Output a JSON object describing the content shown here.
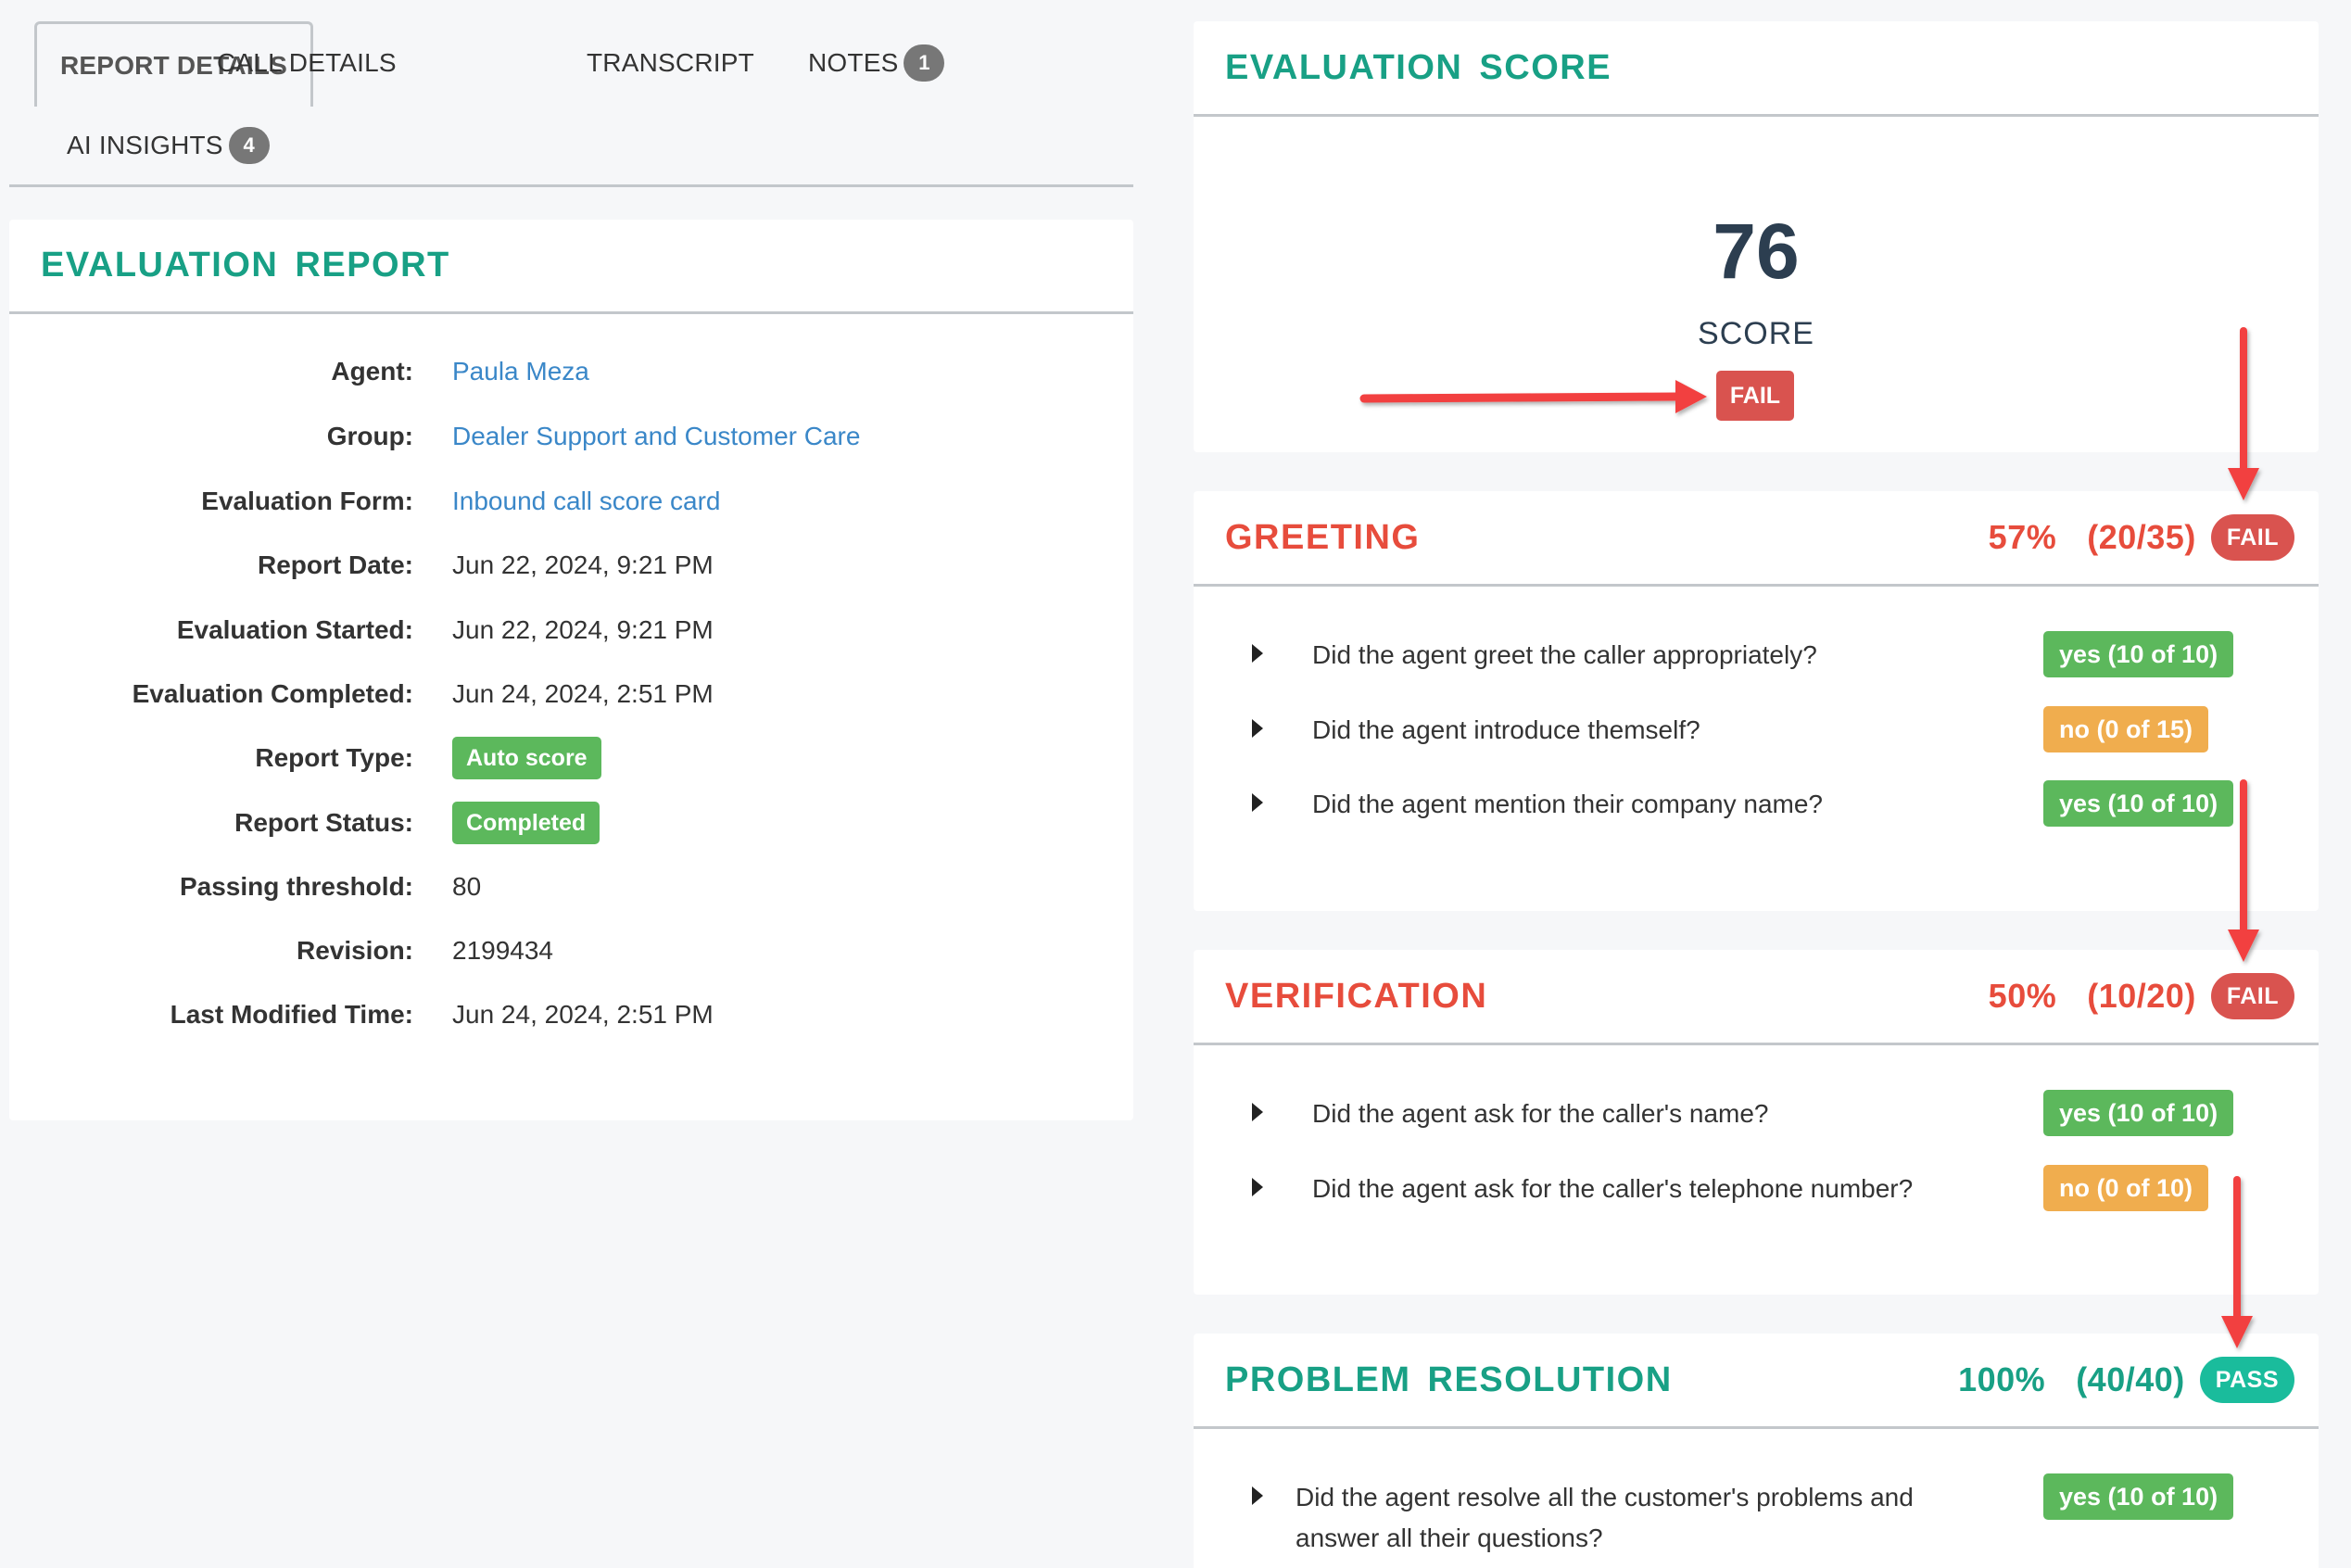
{
  "tabs": [
    {
      "label": "REPORT DETAILS",
      "active": true
    },
    {
      "label": "CALL DETAILS"
    },
    {
      "label": "TRANSCRIPT"
    },
    {
      "label": "NOTES",
      "count": "1"
    },
    {
      "label": "AI INSIGHTS",
      "count": "4"
    }
  ],
  "report": {
    "title": "EVALUATION REPORT",
    "rows": [
      {
        "label": "Agent:",
        "value": "Paula Meza",
        "type": "link"
      },
      {
        "label": "Group:",
        "value": "Dealer Support and Customer Care",
        "type": "link"
      },
      {
        "label": "Evaluation Form:",
        "value": "Inbound call score card",
        "type": "link"
      },
      {
        "label": "Report Date:",
        "value": "Jun 22, 2024, 9:21 PM",
        "type": "text"
      },
      {
        "label": "Evaluation Started:",
        "value": "Jun 22, 2024, 9:21 PM",
        "type": "text"
      },
      {
        "label": "Evaluation Completed:",
        "value": "Jun 24, 2024, 2:51 PM",
        "type": "text"
      },
      {
        "label": "Report Type:",
        "value": "Auto score",
        "type": "pill"
      },
      {
        "label": "Report Status:",
        "value": "Completed",
        "type": "pill"
      },
      {
        "label": "Passing threshold:",
        "value": "80",
        "type": "text"
      },
      {
        "label": "Revision:",
        "value": "2199434",
        "type": "text"
      },
      {
        "label": "Last Modified Time:",
        "value": "Jun 24, 2024, 2:51 PM",
        "type": "text"
      }
    ]
  },
  "score": {
    "title": "EVALUATION SCORE",
    "value": "76",
    "label": "SCORE",
    "result": "FAIL"
  },
  "sections": [
    {
      "title": "GREETING",
      "percent": "57%",
      "points": "(20/35)",
      "result": "FAIL",
      "status": "fail",
      "questions": [
        {
          "text": "Did the agent greet the caller appropriately?",
          "answer": "yes (10 of 10)",
          "status": "yes"
        },
        {
          "text": "Did the agent introduce themself?",
          "answer": "no (0 of 15)",
          "status": "no"
        },
        {
          "text": "Did the agent mention their company name?",
          "answer": "yes (10 of 10)",
          "status": "yes"
        }
      ]
    },
    {
      "title": "VERIFICATION",
      "percent": "50%",
      "points": "(10/20)",
      "result": "FAIL",
      "status": "fail",
      "questions": [
        {
          "text": "Did the agent ask for the caller's name?",
          "answer": "yes (10 of 10)",
          "status": "yes"
        },
        {
          "text": "Did the agent ask for the caller's telephone number?",
          "answer": "no (0 of 10)",
          "status": "no"
        }
      ]
    },
    {
      "title": "PROBLEM RESOLUTION",
      "percent": "100%",
      "points": "(40/40)",
      "result": "PASS",
      "status": "pass",
      "questions": [
        {
          "text": "Did the agent resolve all the customer's problems and answer all their questions?",
          "answer": "yes (10 of 10)",
          "status": "yes"
        }
      ]
    }
  ],
  "colors": {
    "accent_teal": "#18a085",
    "fail_red": "#d9534f",
    "section_fail_text": "#e74c3c",
    "pass_teal": "#1abc9c",
    "yes_green": "#5cb85c",
    "no_orange": "#f0ad4e",
    "link_blue": "#3a87c8",
    "annotation_arrow": "#f24040"
  }
}
